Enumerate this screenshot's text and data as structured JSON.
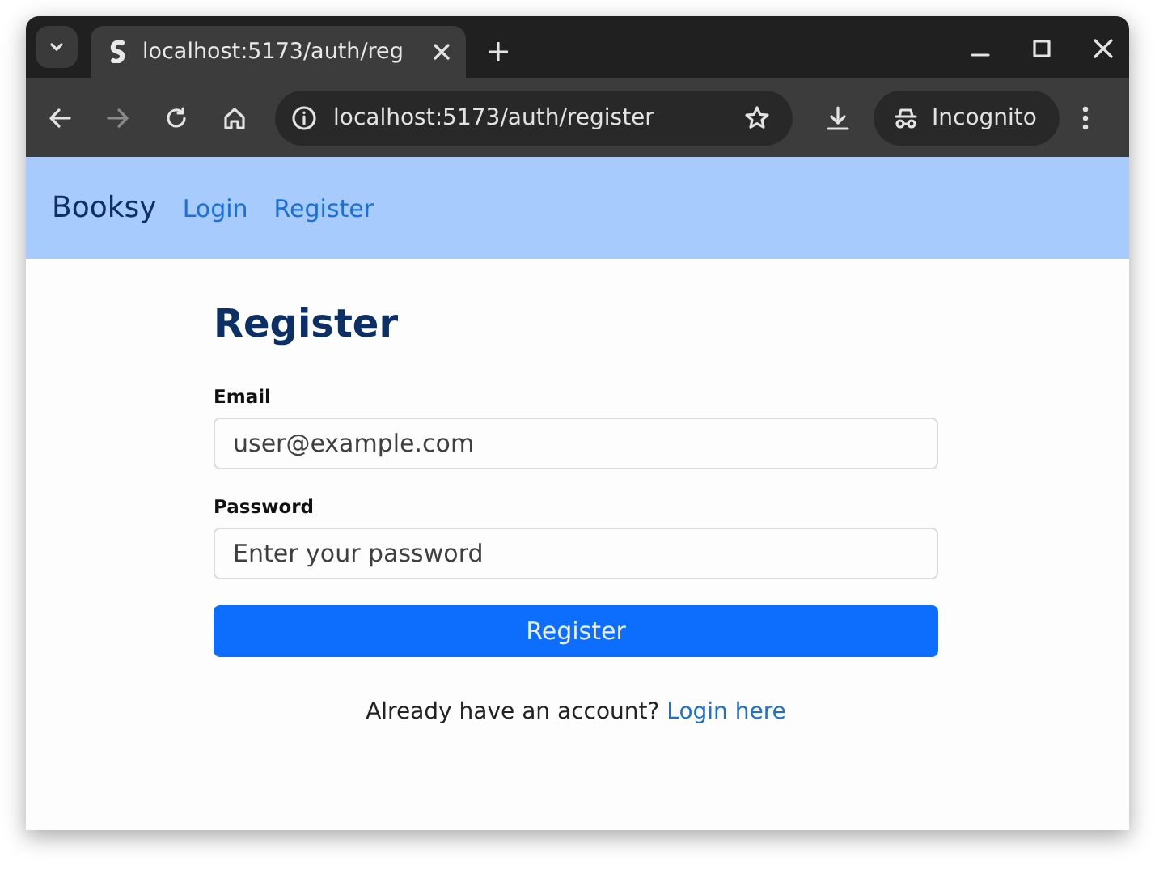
{
  "browser": {
    "tab_title": "localhost:5173/auth/reg",
    "url": "localhost:5173/auth/register",
    "profile": "Incognito"
  },
  "navbar": {
    "brand": "Booksy",
    "links": [
      {
        "label": "Login"
      },
      {
        "label": "Register"
      }
    ]
  },
  "form": {
    "title": "Register",
    "fields": [
      {
        "label": "Email",
        "placeholder": "user@example.com"
      },
      {
        "label": "Password",
        "placeholder": "Enter your password"
      }
    ],
    "submit": "Register",
    "footer": {
      "text": "Already have an account?",
      "link": "Login here"
    }
  }
}
